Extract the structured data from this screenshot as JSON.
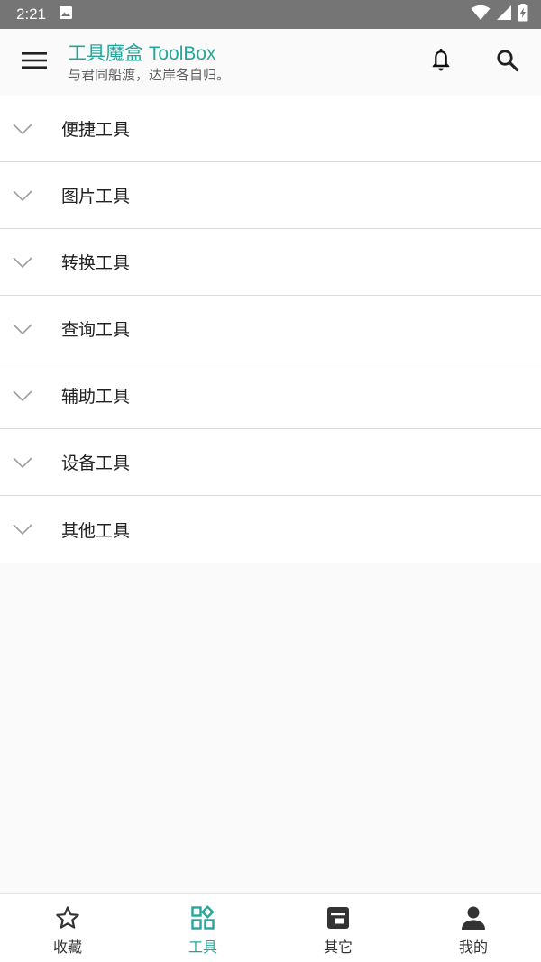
{
  "status_bar": {
    "time": "2:21",
    "icons": [
      "image-notification-icon",
      "wifi-icon",
      "cell-signal-icon",
      "battery-charging-icon"
    ]
  },
  "app_bar": {
    "title": "工具魔盒 ToolBox",
    "subtitle": "与君同船渡，达岸各自归。",
    "accent_color": "#26a69a"
  },
  "tool_categories": [
    {
      "label": "便捷工具"
    },
    {
      "label": "图片工具"
    },
    {
      "label": "转换工具"
    },
    {
      "label": "查询工具"
    },
    {
      "label": "辅助工具"
    },
    {
      "label": "设备工具"
    },
    {
      "label": "其他工具"
    }
  ],
  "bottom_nav": {
    "items": [
      {
        "label": "收藏",
        "icon": "star-icon",
        "active": false
      },
      {
        "label": "工具",
        "icon": "widgets-icon",
        "active": true
      },
      {
        "label": "其它",
        "icon": "tray-icon",
        "active": false
      },
      {
        "label": "我的",
        "icon": "person-icon",
        "active": false
      }
    ]
  }
}
